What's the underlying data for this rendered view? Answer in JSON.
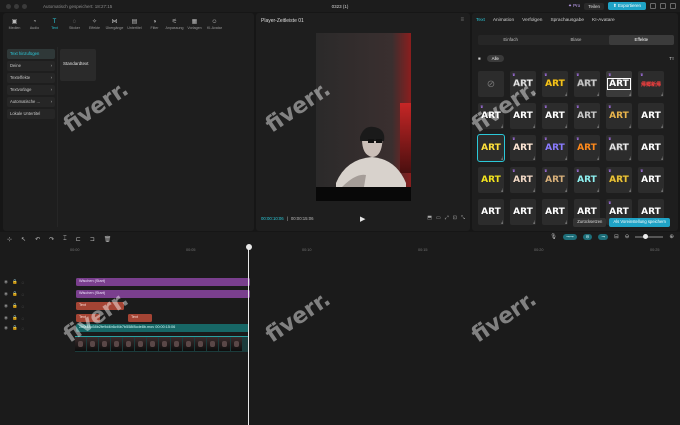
{
  "titlebar": {
    "autosave": "Automatisch gespeichert: 18:27:15",
    "project_name": "0323 (1)",
    "pro_label": "Pro",
    "share_label": "Teilen",
    "export_label": "Exportieren"
  },
  "toolbar": {
    "items": [
      {
        "label": "Medien",
        "icon": "media-icon",
        "glyph": "▣"
      },
      {
        "label": "Audio",
        "icon": "audio-icon",
        "glyph": "◔"
      },
      {
        "label": "Text",
        "icon": "text-icon",
        "glyph": "T"
      },
      {
        "label": "Sticker",
        "icon": "sticker-icon",
        "glyph": "◌"
      },
      {
        "label": "Effekte",
        "icon": "effects-icon",
        "glyph": "✧"
      },
      {
        "label": "Übergänge",
        "icon": "transitions-icon",
        "glyph": "⋈"
      },
      {
        "label": "Untertitel",
        "icon": "subtitles-icon",
        "glyph": "▤"
      },
      {
        "label": "Filter",
        "icon": "filter-icon",
        "glyph": "◑"
      },
      {
        "label": "Anpassung",
        "icon": "adjust-icon",
        "glyph": "⚟"
      },
      {
        "label": "Vorlagen",
        "icon": "templates-icon",
        "glyph": "▦"
      },
      {
        "label": "KI-Avatar",
        "icon": "ai-avatar-icon",
        "glyph": "☺"
      }
    ],
    "active_index": 2
  },
  "left_sub": {
    "items": [
      {
        "label": "Text hinzufügen",
        "arrow": ""
      },
      {
        "label": "Deine",
        "arrow": "›"
      },
      {
        "label": "Texteffekte",
        "arrow": "›"
      },
      {
        "label": "Textvorlage",
        "arrow": "›"
      },
      {
        "label": "Automatische ...",
        "arrow": "›"
      },
      {
        "label": "Lokale Untertitel",
        "arrow": ""
      }
    ],
    "card_label": "Standardtext"
  },
  "player": {
    "title": "Player-Zeitleiste 01",
    "current_time": "00:00:10:06",
    "total_time": "00:00:15:06"
  },
  "right_panel": {
    "tabs": [
      "Text",
      "Animation",
      "Verfolgen",
      "Sprachausgabe",
      "KI-Avatare"
    ],
    "active_tab": 0,
    "segments": [
      "Einfach",
      "Blase",
      "Effekte"
    ],
    "active_segment": 2,
    "filter_chip": "Alle",
    "ty_label": "Tт",
    "cells": [
      {
        "text": "⊘",
        "style": "none",
        "fg": "#777777",
        "bg": "#2c2c2c",
        "crown": false
      },
      {
        "text": "ART",
        "style": "outline",
        "fg": "#ffffff",
        "bg": "#2c2c2c",
        "crown": true
      },
      {
        "text": "ART",
        "style": "gold",
        "fg": "#f4c31b",
        "bg": "#2c2c2c",
        "crown": true
      },
      {
        "text": "ART",
        "style": "chrome",
        "fg": "#d9d9d9",
        "bg": "#2c2c2c",
        "crown": true
      },
      {
        "text": "ART",
        "style": "boxed",
        "fg": "#ffffff",
        "bg": "#3a3a3a",
        "crown": true
      },
      {
        "text": "帰郷新帰",
        "style": "red",
        "fg": "#ff4040",
        "bg": "#2c2c2c",
        "crown": true
      },
      {
        "text": "ART",
        "style": "white",
        "fg": "#ffffff",
        "bg": "#2c2c2c",
        "crown": true
      },
      {
        "text": "ART",
        "style": "white",
        "fg": "#ffffff",
        "bg": "#2c2c2c",
        "crown": false
      },
      {
        "text": "ART",
        "style": "white",
        "fg": "#ffffff",
        "bg": "#2c2c2c",
        "crown": true
      },
      {
        "text": "ART",
        "style": "silver",
        "fg": "#c9c9c9",
        "bg": "#2c2c2c",
        "crown": true
      },
      {
        "text": "ART",
        "style": "goldstrike",
        "fg": "#e9b44c",
        "bg": "#2c2c2c",
        "crown": true
      },
      {
        "text": "ART",
        "style": "white",
        "fg": "#ffffff",
        "bg": "#2c2c2c",
        "crown": false
      },
      {
        "text": "ART",
        "style": "yellow",
        "fg": "#ffe13b",
        "bg": "#2c2c2c",
        "crown": false
      },
      {
        "text": "ART",
        "style": "pastel",
        "fg": "#ffe7d6",
        "bg": "#2c2c2c",
        "crown": true
      },
      {
        "text": "ART",
        "style": "purple",
        "fg": "#8a7bff",
        "bg": "#2c2c2c",
        "crown": true
      },
      {
        "text": "ART",
        "style": "orange",
        "fg": "#ff8a1c",
        "bg": "#2c2c2c",
        "crown": true
      },
      {
        "text": "ART",
        "style": "outline",
        "fg": "#ffffff",
        "bg": "#2c2c2c",
        "crown": true
      },
      {
        "text": "ART",
        "style": "white",
        "fg": "#ffffff",
        "bg": "#2c2c2c",
        "crown": false
      },
      {
        "text": "ART",
        "style": "yellow",
        "fg": "#f3e41f",
        "bg": "#2c2c2c",
        "crown": false
      },
      {
        "text": "ART",
        "style": "cream",
        "fg": "#f2d9c6",
        "bg": "#2c2c2c",
        "crown": true
      },
      {
        "text": "ART",
        "style": "bronze",
        "fg": "#d8b07a",
        "bg": "#2c2c2c",
        "crown": true
      },
      {
        "text": "ART",
        "style": "teal",
        "fg": "#8ef0f0",
        "bg": "#2c2c2c",
        "crown": true
      },
      {
        "text": "ART",
        "style": "gold",
        "fg": "#e8c23a",
        "bg": "#2c2c2c",
        "crown": true
      },
      {
        "text": "ART",
        "style": "white",
        "fg": "#ffffff",
        "bg": "#2c2c2c",
        "crown": true
      },
      {
        "text": "ART",
        "style": "white",
        "fg": "#ffffff",
        "bg": "#2c2c2c",
        "crown": false
      },
      {
        "text": "ART",
        "style": "white",
        "fg": "#ffffff",
        "bg": "#2c2c2c",
        "crown": false
      },
      {
        "text": "ART",
        "style": "white",
        "fg": "#ffffff",
        "bg": "#2c2c2c",
        "crown": false
      },
      {
        "text": "ART",
        "style": "white",
        "fg": "#ffffff",
        "bg": "#2c2c2c",
        "crown": false
      },
      {
        "text": "ART",
        "style": "white",
        "fg": "#ffffff",
        "bg": "#2c2c2c",
        "crown": true
      },
      {
        "text": "ART",
        "style": "white",
        "fg": "#ffffff",
        "bg": "#2c2c2c",
        "crown": false
      }
    ],
    "selected_index": 12,
    "reset_label": "Zurücksetzen",
    "save_preset_label": "Als Voreinstellung speichern"
  },
  "timeline": {
    "ruler_labels": [
      "00:00",
      "00:05",
      "00:10",
      "00:15",
      "00:20",
      "00:25"
    ],
    "tracks": [
      {
        "label": "Wischen (Start)",
        "color": "purple",
        "kind": "effect"
      },
      {
        "label": "Wischen (Start)",
        "color": "purple",
        "kind": "effect"
      },
      {
        "label": "Text",
        "color": "red",
        "kind": "text"
      },
      {
        "label": "Text",
        "color": "red",
        "kind": "text"
      },
      {
        "label": "2b0f48c58b2fe9d4b6cf4b7b558f8cde8b.mov   00:00:15:06",
        "color": "teal",
        "kind": "video"
      }
    ]
  },
  "watermark": "fiverr."
}
